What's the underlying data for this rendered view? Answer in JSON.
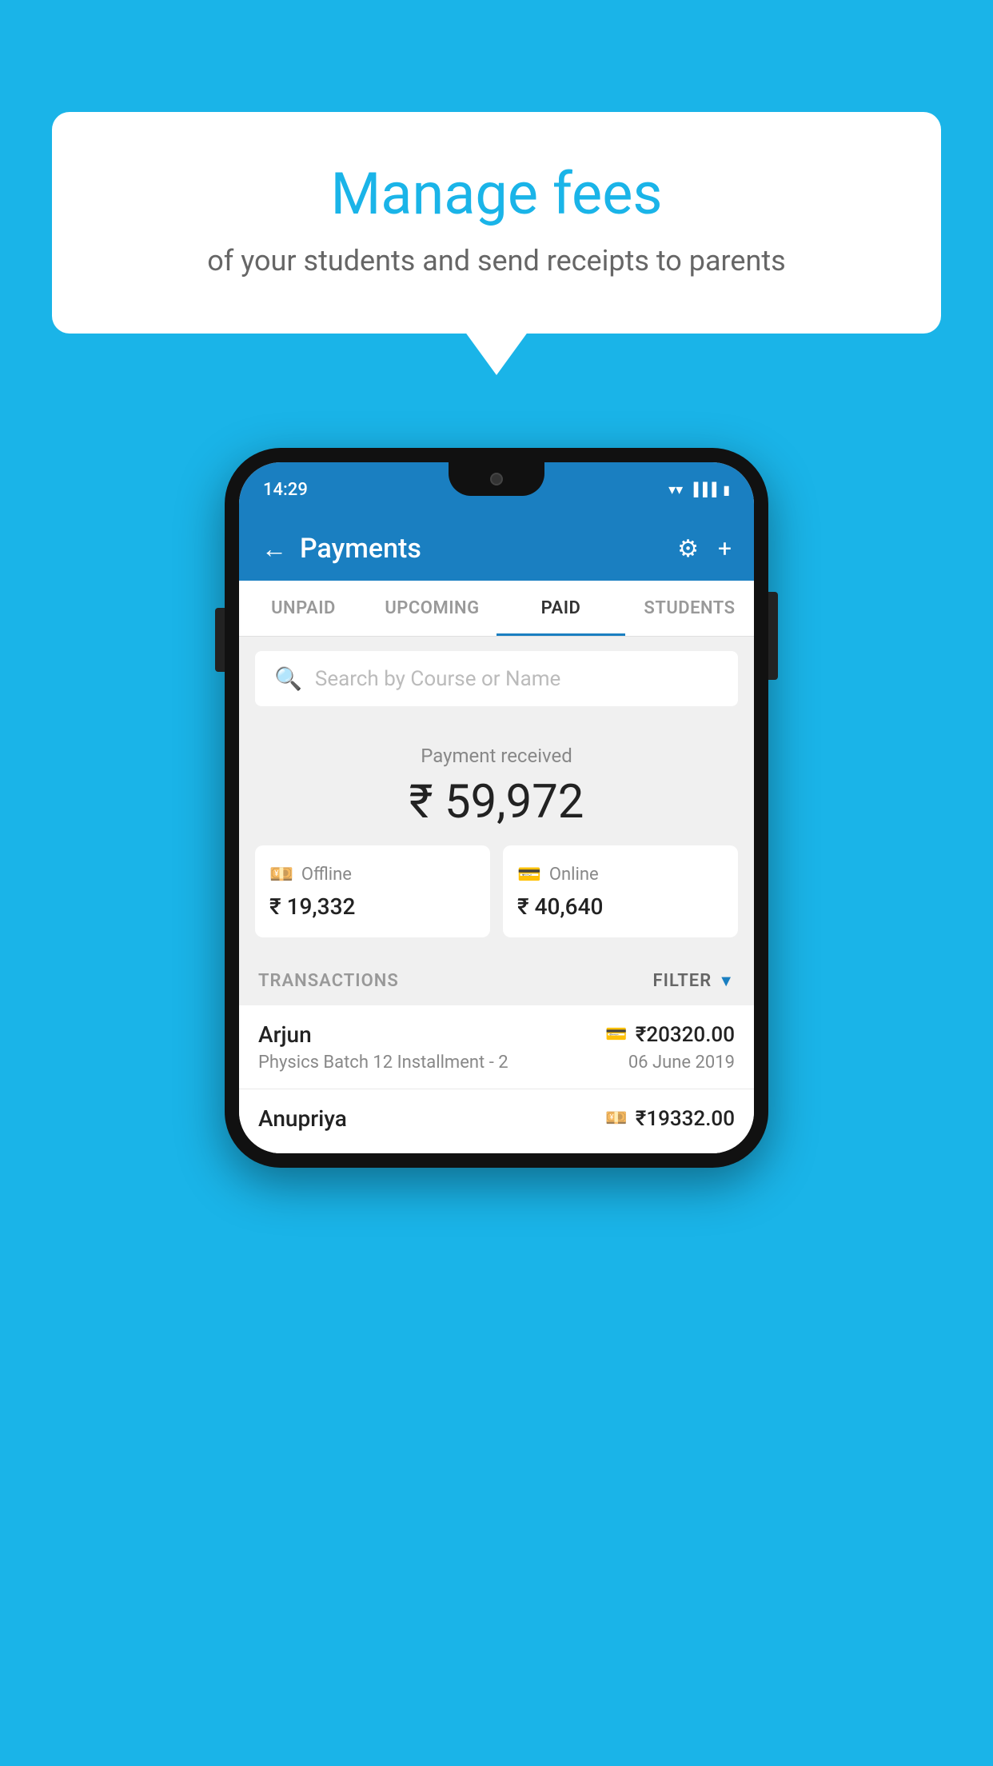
{
  "background_color": "#1ab4e8",
  "speech_bubble": {
    "title": "Manage fees",
    "subtitle": "of your students and send receipts to parents"
  },
  "phone": {
    "status_bar": {
      "time": "14:29"
    },
    "toolbar": {
      "title": "Payments",
      "back_label": "←",
      "settings_label": "⚙",
      "add_label": "+"
    },
    "tabs": [
      {
        "label": "UNPAID",
        "active": false
      },
      {
        "label": "UPCOMING",
        "active": false
      },
      {
        "label": "PAID",
        "active": true
      },
      {
        "label": "STUDENTS",
        "active": false
      }
    ],
    "search": {
      "placeholder": "Search by Course or Name"
    },
    "payment_summary": {
      "label": "Payment received",
      "total": "₹ 59,972",
      "offline_label": "Offline",
      "offline_amount": "₹ 19,332",
      "online_label": "Online",
      "online_amount": "₹ 40,640"
    },
    "transactions_section": {
      "header_label": "TRANSACTIONS",
      "filter_label": "FILTER"
    },
    "transactions": [
      {
        "name": "Arjun",
        "course": "Physics Batch 12 Installment - 2",
        "amount": "₹20320.00",
        "date": "06 June 2019",
        "payment_type": "online"
      },
      {
        "name": "Anupriya",
        "course": "",
        "amount": "₹19332.00",
        "date": "",
        "payment_type": "offline"
      }
    ]
  }
}
